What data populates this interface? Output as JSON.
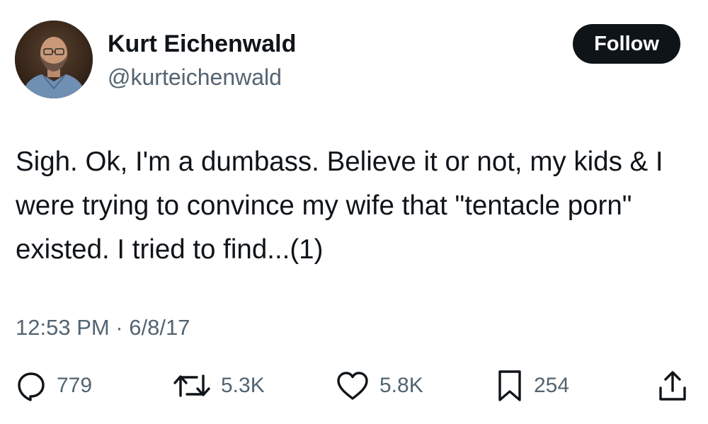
{
  "tweet": {
    "author": {
      "display_name": "Kurt Eichenwald",
      "handle": "@kurteichenwald"
    },
    "follow_label": "Follow",
    "text": "Sigh. Ok, I'm a dumbass. Believe it or not, my kids & I were trying to convince my wife that \"tentacle porn\" existed. I tried to find...(1)",
    "timestamp": "12:53 PM · 6/8/17",
    "stats": {
      "replies": "779",
      "reposts": "5.3K",
      "likes": "5.8K",
      "bookmarks": "254"
    }
  },
  "icons": {
    "reply": "reply-icon",
    "repost": "repost-icon",
    "like": "heart-icon",
    "bookmark": "bookmark-icon",
    "share": "share-icon"
  },
  "colors": {
    "text_primary": "#0f1419",
    "text_secondary": "#536471",
    "button_bg": "#0f1419",
    "button_text": "#ffffff"
  }
}
